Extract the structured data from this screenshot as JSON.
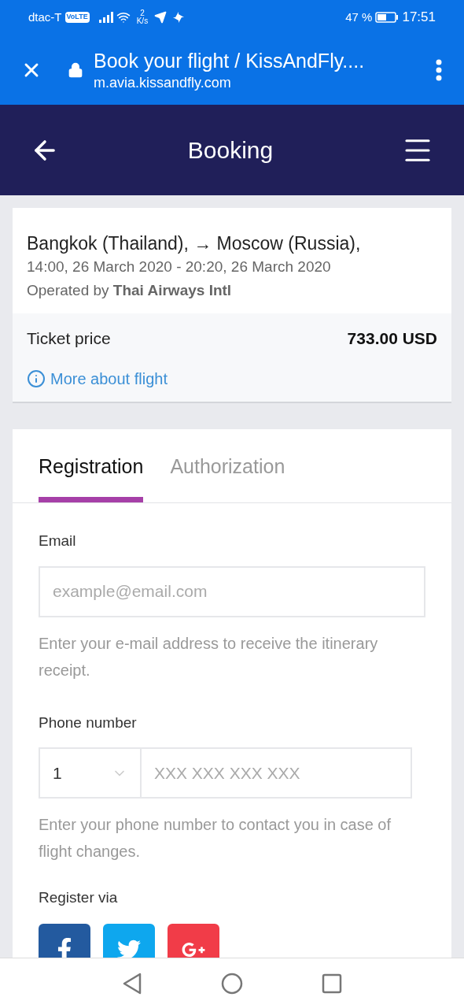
{
  "status_bar": {
    "carrier": "dtac-T",
    "volte": "VoLTE",
    "speed_value": "2",
    "speed_unit": "K/s",
    "battery": "47 %",
    "time": "17:51"
  },
  "browser_bar": {
    "title": "Book your flight / KissAndFly....",
    "url": "m.avia.kissandfly.com"
  },
  "header": {
    "title": "Booking"
  },
  "flight": {
    "route": "Bangkok (Thailand), → Moscow (Russia),",
    "times": "14:00, 26 March 2020 - 20:20, 26 March 2020",
    "operator": "Operated by **Thai Airways Intl**",
    "price_label": "Ticket price",
    "price": "733.00 USD",
    "more_link": "More about flight"
  },
  "tabs": [
    {
      "label": "Registration",
      "selected": true
    },
    {
      "label": "Authorization",
      "selected": false
    }
  ],
  "form": {
    "email_label": "Email",
    "email_placeholder": "example@email.com",
    "email_hint": "Enter your e-mail address to receive the itinerary receipt.",
    "phone_label": "Phone number",
    "country_code": "1",
    "phone_placeholder": "XXX XXX XXX XXX",
    "phone_hint": "Enter your phone number to contact you in case of flight changes.",
    "register_via": "Register via"
  },
  "social": [
    {
      "kind": "facebook",
      "color": "#235a9f"
    },
    {
      "kind": "twitter",
      "color": "#0ea7ee"
    },
    {
      "kind": "google",
      "color": "#f13c48"
    }
  ]
}
